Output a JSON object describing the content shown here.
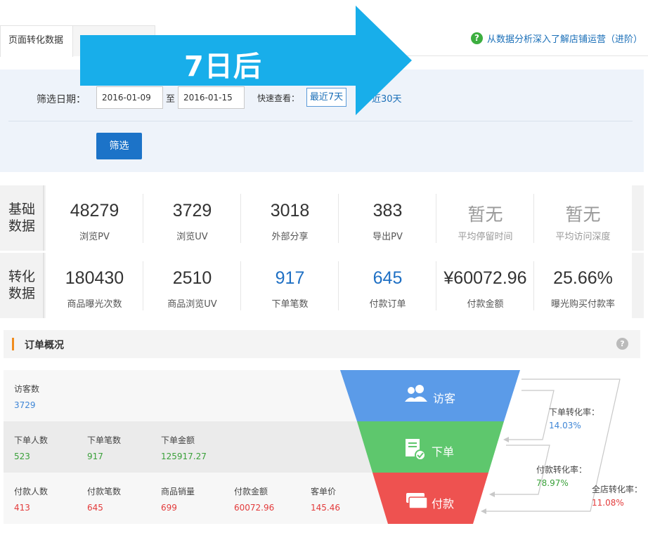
{
  "tabs": [
    {
      "label": "页面转化数据",
      "active": true
    },
    {
      "label": "",
      "active": false
    }
  ],
  "help_link": {
    "icon": "?",
    "text": "从数据分析深入了解店铺运营（进阶）"
  },
  "banner": {
    "text": "7日后",
    "color": "#18aeea"
  },
  "filter": {
    "date_label": "筛选日期：",
    "start_date": "2016-01-09",
    "to_label": "至",
    "end_date": "2016-01-15",
    "quick_label": "快速查看：",
    "quick_7": "最近7天",
    "quick_30": "近30天",
    "button": "筛选"
  },
  "basic": {
    "label": "基础\n数据",
    "cells": [
      {
        "value": "48279",
        "label": "浏览PV"
      },
      {
        "value": "3729",
        "label": "浏览UV"
      },
      {
        "value": "3018",
        "label": "外部分享"
      },
      {
        "value": "383",
        "label": "导出PV"
      },
      {
        "value": "暂无",
        "label": "平均停留时间"
      },
      {
        "value": "暂无",
        "label": "平均访问深度"
      }
    ]
  },
  "conversion": {
    "label": "转化\n数据",
    "cells": [
      {
        "value": "180430",
        "label": "商品曝光次数"
      },
      {
        "value": "2510",
        "label": "商品浏览UV"
      },
      {
        "value": "917",
        "label": "下单笔数"
      },
      {
        "value": "645",
        "label": "付款订单"
      },
      {
        "value": "¥60072.96",
        "label": "付款金额"
      },
      {
        "value": "25.66%",
        "label": "曝光购买付款率"
      }
    ]
  },
  "overview": {
    "title": "订单概况",
    "help": "?",
    "visitors": {
      "label": "访客数",
      "value": "3729"
    },
    "orders": [
      {
        "label": "下单人数",
        "value": "523"
      },
      {
        "label": "下单笔数",
        "value": "917"
      },
      {
        "label": "下单金额",
        "value": "125917.27"
      }
    ],
    "payments": [
      {
        "label": "付款人数",
        "value": "413"
      },
      {
        "label": "付款笔数",
        "value": "645"
      },
      {
        "label": "商品销量",
        "value": "699"
      },
      {
        "label": "付款金额",
        "value": "60072.96"
      },
      {
        "label": "客单价",
        "value": "145.46"
      }
    ]
  },
  "funnel": {
    "stages": [
      "访客",
      "下单",
      "付款"
    ],
    "colors": {
      "visit": "#5b9be8",
      "order": "#5ec76d",
      "pay": "#ee5250"
    },
    "rates": [
      {
        "label": "下单转化率：",
        "value": "14.03%"
      },
      {
        "label": "付款转化率：",
        "value": "78.97%"
      },
      {
        "label": "全店转化率：",
        "value": "11.08%"
      }
    ]
  }
}
